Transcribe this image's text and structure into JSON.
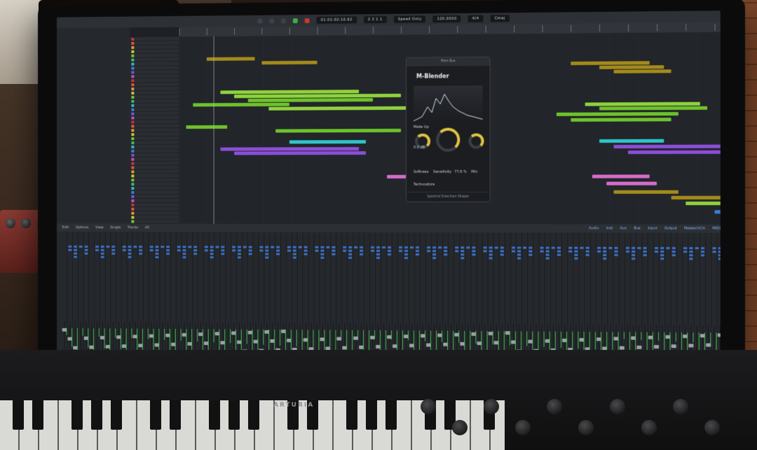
{
  "transport": {
    "position": "01:01:02:10.62",
    "bars": "2  3  1  1",
    "bpm": "120.0000",
    "key": "4/4",
    "mode": "Speed Only",
    "scale": "Cmaj"
  },
  "plugin": {
    "window_label": "Main Bus",
    "title": "M-Blender",
    "sensitivity_label": "Sensitivity",
    "sensitivity_value": "77.6 %",
    "makeup_label": "Make Up",
    "makeup_value": "0.0 dB",
    "softness_label": "Softness",
    "mix_label": "Mix",
    "footer": "Spectral Sidechain Shaper",
    "subfooter": "Technostore"
  },
  "mixer": {
    "tabs": [
      "Edit",
      "Options",
      "View",
      "Single",
      "Tracks",
      "All"
    ],
    "filters": [
      "Audio",
      "Inst",
      "Aux",
      "Bus",
      "Input",
      "Output",
      "Master/VCA",
      "MIDI"
    ]
  },
  "keyboard": {
    "brand": "ARTURIA"
  },
  "colors": {
    "region_olive": "#a38a1b",
    "region_green": "#8fd23d",
    "region_lime": "#6ec22c",
    "region_cyan": "#2fc4c9",
    "region_purple": "#8c4ed8",
    "region_orange": "#d79728",
    "region_pink": "#d46cc8",
    "region_blue": "#3a7bd5"
  }
}
